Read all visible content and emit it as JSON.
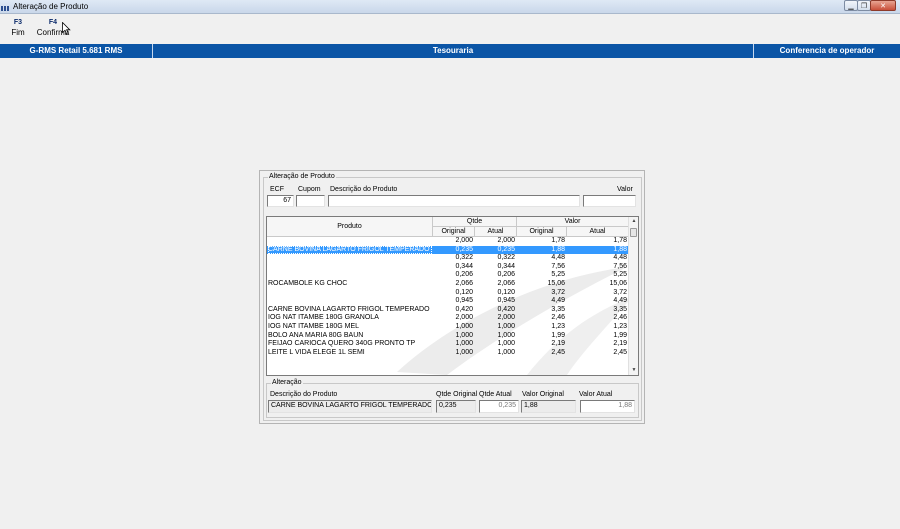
{
  "window": {
    "title": "Alteração de Produto",
    "controls": [
      "minimize",
      "maximize",
      "close"
    ]
  },
  "toolbar": {
    "buttons": [
      {
        "key": "F3",
        "label": "Fim"
      },
      {
        "key": "F4",
        "label": "Confirma"
      }
    ]
  },
  "statusbar": {
    "left": "G-RMS Retail 5.681 RMS",
    "center": "Tesouraria",
    "right": "Conferencia de operador"
  },
  "dialog": {
    "group_title": "Alteração de Produto",
    "header": {
      "ecf_label": "ECF",
      "ecf_value": "67",
      "cupom_label": "Cupom",
      "cupom_value": "",
      "descricao_label": "Descrição do Produto",
      "descricao_value": "",
      "valor_label": "Valor",
      "valor_value": ""
    },
    "grid": {
      "col_produto": "Produto",
      "group_qtde": "Qtde",
      "group_valor": "Valor",
      "sub_original": "Original",
      "sub_atual": "Atual",
      "rows": [
        {
          "produto": "",
          "qtde_orig": "2,000",
          "qtde_atual": "2,000",
          "valor_orig": "1,78",
          "valor_atual": "1,78"
        },
        {
          "produto": "CARNE BOVINA LAGARTO FRIGOL TEMPERADO KG",
          "qtde_orig": "0,235",
          "qtde_atual": "0,235",
          "valor_orig": "1,88",
          "valor_atual": "1,88"
        },
        {
          "produto": "",
          "qtde_orig": "0,322",
          "qtde_atual": "0,322",
          "valor_orig": "4,48",
          "valor_atual": "4,48"
        },
        {
          "produto": "",
          "qtde_orig": "0,344",
          "qtde_atual": "0,344",
          "valor_orig": "7,56",
          "valor_atual": "7,56"
        },
        {
          "produto": "",
          "qtde_orig": "0,206",
          "qtde_atual": "0,206",
          "valor_orig": "5,25",
          "valor_atual": "5,25"
        },
        {
          "produto": "ROCAMBOLE KG CHOC",
          "qtde_orig": "2,066",
          "qtde_atual": "2,066",
          "valor_orig": "15,06",
          "valor_atual": "15,06"
        },
        {
          "produto": "",
          "qtde_orig": "0,120",
          "qtde_atual": "0,120",
          "valor_orig": "3,72",
          "valor_atual": "3,72"
        },
        {
          "produto": "",
          "qtde_orig": "0,945",
          "qtde_atual": "0,945",
          "valor_orig": "4,49",
          "valor_atual": "4,49"
        },
        {
          "produto": "CARNE BOVINA LAGARTO FRIGOL TEMPERADO KG",
          "qtde_orig": "0,420",
          "qtde_atual": "0,420",
          "valor_orig": "3,35",
          "valor_atual": "3,35"
        },
        {
          "produto": "IOG NAT ITAMBE 180G GRANOLA",
          "qtde_orig": "2,000",
          "qtde_atual": "2,000",
          "valor_orig": "2,46",
          "valor_atual": "2,46"
        },
        {
          "produto": "IOG NAT ITAMBE 180G MEL",
          "qtde_orig": "1,000",
          "qtde_atual": "1,000",
          "valor_orig": "1,23",
          "valor_atual": "1,23"
        },
        {
          "produto": "BOLO ANA MARIA 80G BAUN",
          "qtde_orig": "1,000",
          "qtde_atual": "1,000",
          "valor_orig": "1,99",
          "valor_atual": "1,99"
        },
        {
          "produto": "FEIJAO CARIOCA QUERO 340G PRONTO TP",
          "qtde_orig": "1,000",
          "qtde_atual": "1,000",
          "valor_orig": "2,19",
          "valor_atual": "2,19"
        },
        {
          "produto": "LEITE L VIDA ELEGE 1L SEMI",
          "qtde_orig": "1,000",
          "qtde_atual": "1,000",
          "valor_orig": "2,45",
          "valor_atual": "2,45"
        }
      ],
      "selected_index": 1
    },
    "alteracao": {
      "group_title": "Alteração",
      "descricao_label": "Descrição do Produto",
      "qtde_original_label": "Qtde Original",
      "qtde_atual_label": "Qtde Atual",
      "valor_original_label": "Valor Original",
      "valor_atual_label": "Valor Atual",
      "descricao_value": "CARNE BOVINA LAGARTO FRIGOL TEMPERADO",
      "qtde_original_value": "0,235",
      "qtde_atual_value": "0,235",
      "valor_original_value": "1,88",
      "valor_atual_value": "1,88"
    }
  },
  "colors": {
    "statusbar_bg": "#0b55a6",
    "selection": "#3399ff"
  }
}
